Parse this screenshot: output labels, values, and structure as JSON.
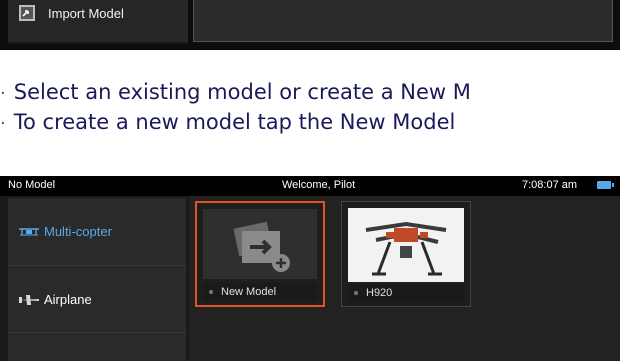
{
  "top_screen": {
    "sidebar": {
      "import_label": "Import Model"
    }
  },
  "instructions": [
    "Select an existing model or create a New M",
    "To create a new model tap the New Model"
  ],
  "status_bar": {
    "left": "No Model",
    "center": "Welcome, Pilot",
    "time": "7:08:07 am"
  },
  "categories": [
    {
      "label": "Multi-copter",
      "icon": "multicopter-icon",
      "active": true
    },
    {
      "label": "Airplane",
      "icon": "airplane-icon",
      "active": false
    }
  ],
  "models": [
    {
      "label": "New Model",
      "icon": "new-model-icon",
      "selected": true
    },
    {
      "label": "H920",
      "icon": "drone-photo",
      "selected": false
    }
  ],
  "colors": {
    "accent": "#5aa9e6",
    "selection": "#e2552a",
    "instruction_text": "#1a1a5a"
  }
}
